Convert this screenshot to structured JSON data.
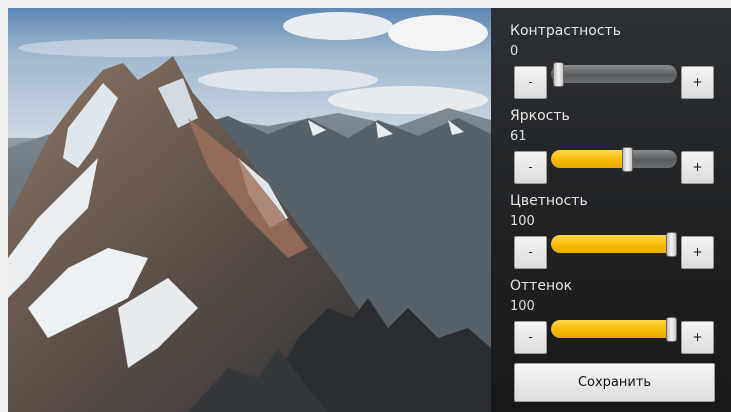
{
  "controls": [
    {
      "label": "Контрастность",
      "value": "0",
      "level": 0,
      "minus": "-",
      "plus": "+"
    },
    {
      "label": "Яркость",
      "value": "61",
      "level": 61,
      "minus": "-",
      "plus": "+"
    },
    {
      "label": "Цветность",
      "value": "100",
      "level": 100,
      "minus": "-",
      "plus": "+"
    },
    {
      "label": "Оттенок",
      "value": "100",
      "level": 100,
      "minus": "-",
      "plus": "+"
    }
  ],
  "save_label": "Сохранить",
  "colors": {
    "accent": "#f6b800",
    "panel": "#1f2123",
    "track": "#6c6f72"
  }
}
